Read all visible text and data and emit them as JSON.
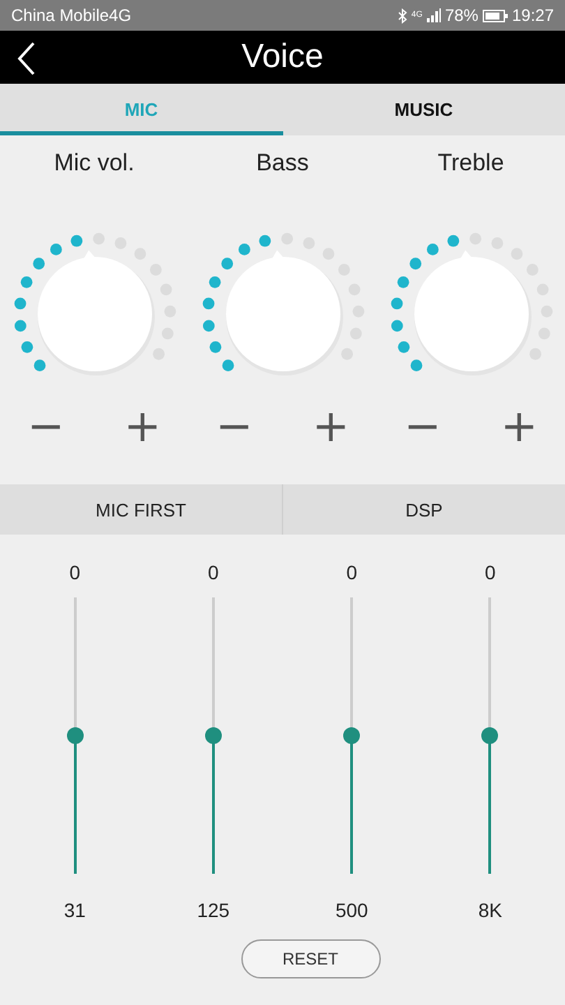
{
  "status_bar": {
    "carrier": "China Mobile4G",
    "network": "4G",
    "battery": "78%",
    "time": "19:27"
  },
  "window": {
    "title": "Voice"
  },
  "tabs": [
    {
      "label": "MIC",
      "selected": true
    },
    {
      "label": "MUSIC",
      "selected": false
    }
  ],
  "knobs": [
    {
      "label": "Mic vol.",
      "minus": "−",
      "plus": "+"
    },
    {
      "label": "Bass",
      "minus": "−",
      "plus": "+"
    },
    {
      "label": "Treble",
      "minus": "−",
      "plus": "+"
    }
  ],
  "modes": [
    {
      "label": "MIC FIRST"
    },
    {
      "label": "DSP"
    }
  ],
  "equalizer": [
    {
      "value": "0",
      "level": 0.5,
      "band": "31"
    },
    {
      "value": "0",
      "level": 0.5,
      "band": "125"
    },
    {
      "value": "0",
      "level": 0.5,
      "band": "500"
    },
    {
      "value": "0",
      "level": 0.5,
      "band": "8K"
    }
  ],
  "reset_button": "RESET"
}
